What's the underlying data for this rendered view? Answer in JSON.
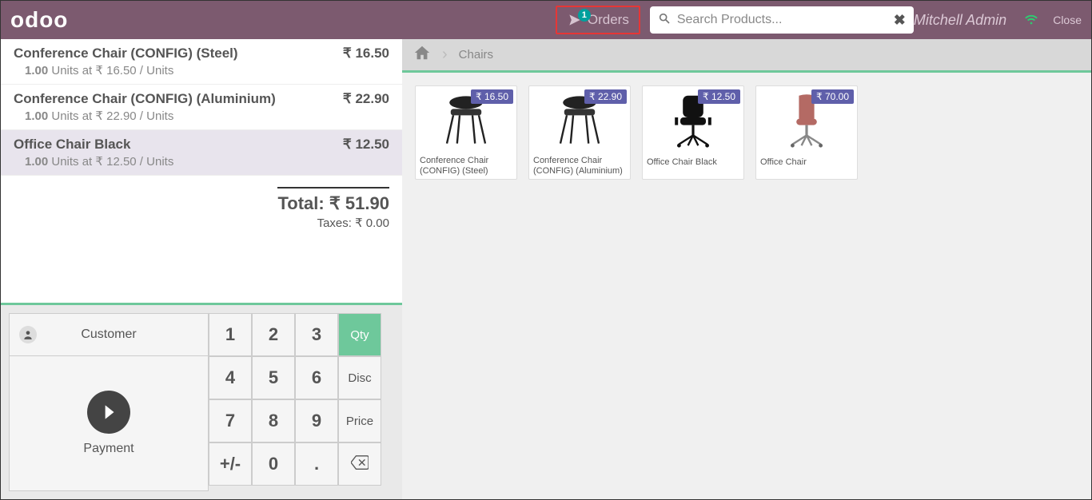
{
  "header": {
    "logo": "odoo",
    "orders_label": "Orders",
    "orders_badge": "1",
    "search_placeholder": "Search Products...",
    "username": "Mitchell Admin",
    "close_label": "Close"
  },
  "breadcrumbs": {
    "current": "Chairs"
  },
  "order": {
    "lines": [
      {
        "product": "Conference Chair (CONFIG) (Steel)",
        "qty": "1.00",
        "unit": "Units at ₹ 16.50 / Units",
        "price": "₹ 16.50",
        "selected": false
      },
      {
        "product": "Conference Chair (CONFIG) (Aluminium)",
        "qty": "1.00",
        "unit": "Units at ₹ 22.90 / Units",
        "price": "₹ 22.90",
        "selected": false
      },
      {
        "product": "Office Chair Black",
        "qty": "1.00",
        "unit": "Units at ₹ 12.50 / Units",
        "price": "₹ 12.50",
        "selected": true
      }
    ],
    "total_label": "Total: ₹ 51.90",
    "taxes_label": "Taxes: ₹ 0.00"
  },
  "actionpad": {
    "customer_label": "Customer",
    "payment_label": "Payment"
  },
  "numpad": {
    "k1": "1",
    "k2": "2",
    "k3": "3",
    "qty": "Qty",
    "k4": "4",
    "k5": "5",
    "k6": "6",
    "disc": "Disc",
    "k7": "7",
    "k8": "8",
    "k9": "9",
    "price": "Price",
    "pm": "+/-",
    "k0": "0",
    "dot": "."
  },
  "products": [
    {
      "name": "Conference Chair (CONFIG) (Steel)",
      "price": "₹ 16.50",
      "style": "conf"
    },
    {
      "name": "Conference Chair (CONFIG) (Aluminium)",
      "price": "₹ 22.90",
      "style": "conf"
    },
    {
      "name": "Office Chair Black",
      "price": "₹ 12.50",
      "style": "office-black"
    },
    {
      "name": "Office Chair",
      "price": "₹ 70.00",
      "style": "office-pink"
    }
  ]
}
